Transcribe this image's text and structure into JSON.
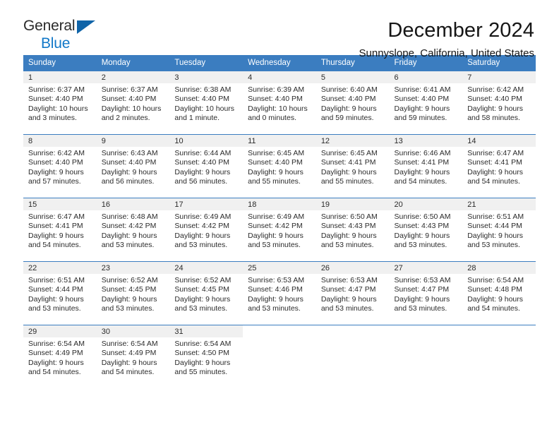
{
  "logo": {
    "word_top": "General",
    "word_bottom": "Blue",
    "triangle_icon": "triangle-icon",
    "color_top": "#2b2b2b",
    "color_bottom": "#1278c8",
    "triangle_color": "#1064a8"
  },
  "header": {
    "title": "December 2024",
    "subtitle": "Sunnyslope, California, United States"
  },
  "theme": {
    "header_bg": "#3b7dc0",
    "header_text": "#ffffff",
    "date_band_bg": "#f0f0f0",
    "cell_bg": "#ffffff",
    "body_text": "#2b2b2b"
  },
  "weekdays": [
    "Sunday",
    "Monday",
    "Tuesday",
    "Wednesday",
    "Thursday",
    "Friday",
    "Saturday"
  ],
  "labels": {
    "sunrise_prefix": "Sunrise:",
    "sunset_prefix": "Sunset:",
    "daylight_prefix": "Daylight:"
  },
  "weeks": [
    [
      {
        "date": "1",
        "sunrise": "Sunrise: 6:37 AM",
        "sunset": "Sunset: 4:40 PM",
        "daylight_l1": "Daylight: 10 hours",
        "daylight_l2": "and 3 minutes."
      },
      {
        "date": "2",
        "sunrise": "Sunrise: 6:37 AM",
        "sunset": "Sunset: 4:40 PM",
        "daylight_l1": "Daylight: 10 hours",
        "daylight_l2": "and 2 minutes."
      },
      {
        "date": "3",
        "sunrise": "Sunrise: 6:38 AM",
        "sunset": "Sunset: 4:40 PM",
        "daylight_l1": "Daylight: 10 hours",
        "daylight_l2": "and 1 minute."
      },
      {
        "date": "4",
        "sunrise": "Sunrise: 6:39 AM",
        "sunset": "Sunset: 4:40 PM",
        "daylight_l1": "Daylight: 10 hours",
        "daylight_l2": "and 0 minutes."
      },
      {
        "date": "5",
        "sunrise": "Sunrise: 6:40 AM",
        "sunset": "Sunset: 4:40 PM",
        "daylight_l1": "Daylight: 9 hours",
        "daylight_l2": "and 59 minutes."
      },
      {
        "date": "6",
        "sunrise": "Sunrise: 6:41 AM",
        "sunset": "Sunset: 4:40 PM",
        "daylight_l1": "Daylight: 9 hours",
        "daylight_l2": "and 59 minutes."
      },
      {
        "date": "7",
        "sunrise": "Sunrise: 6:42 AM",
        "sunset": "Sunset: 4:40 PM",
        "daylight_l1": "Daylight: 9 hours",
        "daylight_l2": "and 58 minutes."
      }
    ],
    [
      {
        "date": "8",
        "sunrise": "Sunrise: 6:42 AM",
        "sunset": "Sunset: 4:40 PM",
        "daylight_l1": "Daylight: 9 hours",
        "daylight_l2": "and 57 minutes."
      },
      {
        "date": "9",
        "sunrise": "Sunrise: 6:43 AM",
        "sunset": "Sunset: 4:40 PM",
        "daylight_l1": "Daylight: 9 hours",
        "daylight_l2": "and 56 minutes."
      },
      {
        "date": "10",
        "sunrise": "Sunrise: 6:44 AM",
        "sunset": "Sunset: 4:40 PM",
        "daylight_l1": "Daylight: 9 hours",
        "daylight_l2": "and 56 minutes."
      },
      {
        "date": "11",
        "sunrise": "Sunrise: 6:45 AM",
        "sunset": "Sunset: 4:40 PM",
        "daylight_l1": "Daylight: 9 hours",
        "daylight_l2": "and 55 minutes."
      },
      {
        "date": "12",
        "sunrise": "Sunrise: 6:45 AM",
        "sunset": "Sunset: 4:41 PM",
        "daylight_l1": "Daylight: 9 hours",
        "daylight_l2": "and 55 minutes."
      },
      {
        "date": "13",
        "sunrise": "Sunrise: 6:46 AM",
        "sunset": "Sunset: 4:41 PM",
        "daylight_l1": "Daylight: 9 hours",
        "daylight_l2": "and 54 minutes."
      },
      {
        "date": "14",
        "sunrise": "Sunrise: 6:47 AM",
        "sunset": "Sunset: 4:41 PM",
        "daylight_l1": "Daylight: 9 hours",
        "daylight_l2": "and 54 minutes."
      }
    ],
    [
      {
        "date": "15",
        "sunrise": "Sunrise: 6:47 AM",
        "sunset": "Sunset: 4:41 PM",
        "daylight_l1": "Daylight: 9 hours",
        "daylight_l2": "and 54 minutes."
      },
      {
        "date": "16",
        "sunrise": "Sunrise: 6:48 AM",
        "sunset": "Sunset: 4:42 PM",
        "daylight_l1": "Daylight: 9 hours",
        "daylight_l2": "and 53 minutes."
      },
      {
        "date": "17",
        "sunrise": "Sunrise: 6:49 AM",
        "sunset": "Sunset: 4:42 PM",
        "daylight_l1": "Daylight: 9 hours",
        "daylight_l2": "and 53 minutes."
      },
      {
        "date": "18",
        "sunrise": "Sunrise: 6:49 AM",
        "sunset": "Sunset: 4:42 PM",
        "daylight_l1": "Daylight: 9 hours",
        "daylight_l2": "and 53 minutes."
      },
      {
        "date": "19",
        "sunrise": "Sunrise: 6:50 AM",
        "sunset": "Sunset: 4:43 PM",
        "daylight_l1": "Daylight: 9 hours",
        "daylight_l2": "and 53 minutes."
      },
      {
        "date": "20",
        "sunrise": "Sunrise: 6:50 AM",
        "sunset": "Sunset: 4:43 PM",
        "daylight_l1": "Daylight: 9 hours",
        "daylight_l2": "and 53 minutes."
      },
      {
        "date": "21",
        "sunrise": "Sunrise: 6:51 AM",
        "sunset": "Sunset: 4:44 PM",
        "daylight_l1": "Daylight: 9 hours",
        "daylight_l2": "and 53 minutes."
      }
    ],
    [
      {
        "date": "22",
        "sunrise": "Sunrise: 6:51 AM",
        "sunset": "Sunset: 4:44 PM",
        "daylight_l1": "Daylight: 9 hours",
        "daylight_l2": "and 53 minutes."
      },
      {
        "date": "23",
        "sunrise": "Sunrise: 6:52 AM",
        "sunset": "Sunset: 4:45 PM",
        "daylight_l1": "Daylight: 9 hours",
        "daylight_l2": "and 53 minutes."
      },
      {
        "date": "24",
        "sunrise": "Sunrise: 6:52 AM",
        "sunset": "Sunset: 4:45 PM",
        "daylight_l1": "Daylight: 9 hours",
        "daylight_l2": "and 53 minutes."
      },
      {
        "date": "25",
        "sunrise": "Sunrise: 6:53 AM",
        "sunset": "Sunset: 4:46 PM",
        "daylight_l1": "Daylight: 9 hours",
        "daylight_l2": "and 53 minutes."
      },
      {
        "date": "26",
        "sunrise": "Sunrise: 6:53 AM",
        "sunset": "Sunset: 4:47 PM",
        "daylight_l1": "Daylight: 9 hours",
        "daylight_l2": "and 53 minutes."
      },
      {
        "date": "27",
        "sunrise": "Sunrise: 6:53 AM",
        "sunset": "Sunset: 4:47 PM",
        "daylight_l1": "Daylight: 9 hours",
        "daylight_l2": "and 53 minutes."
      },
      {
        "date": "28",
        "sunrise": "Sunrise: 6:54 AM",
        "sunset": "Sunset: 4:48 PM",
        "daylight_l1": "Daylight: 9 hours",
        "daylight_l2": "and 54 minutes."
      }
    ],
    [
      {
        "date": "29",
        "sunrise": "Sunrise: 6:54 AM",
        "sunset": "Sunset: 4:49 PM",
        "daylight_l1": "Daylight: 9 hours",
        "daylight_l2": "and 54 minutes."
      },
      {
        "date": "30",
        "sunrise": "Sunrise: 6:54 AM",
        "sunset": "Sunset: 4:49 PM",
        "daylight_l1": "Daylight: 9 hours",
        "daylight_l2": "and 54 minutes."
      },
      {
        "date": "31",
        "sunrise": "Sunrise: 6:54 AM",
        "sunset": "Sunset: 4:50 PM",
        "daylight_l1": "Daylight: 9 hours",
        "daylight_l2": "and 55 minutes."
      },
      {
        "date": "",
        "sunrise": "",
        "sunset": "",
        "daylight_l1": "",
        "daylight_l2": ""
      },
      {
        "date": "",
        "sunrise": "",
        "sunset": "",
        "daylight_l1": "",
        "daylight_l2": ""
      },
      {
        "date": "",
        "sunrise": "",
        "sunset": "",
        "daylight_l1": "",
        "daylight_l2": ""
      },
      {
        "date": "",
        "sunrise": "",
        "sunset": "",
        "daylight_l1": "",
        "daylight_l2": ""
      }
    ]
  ]
}
